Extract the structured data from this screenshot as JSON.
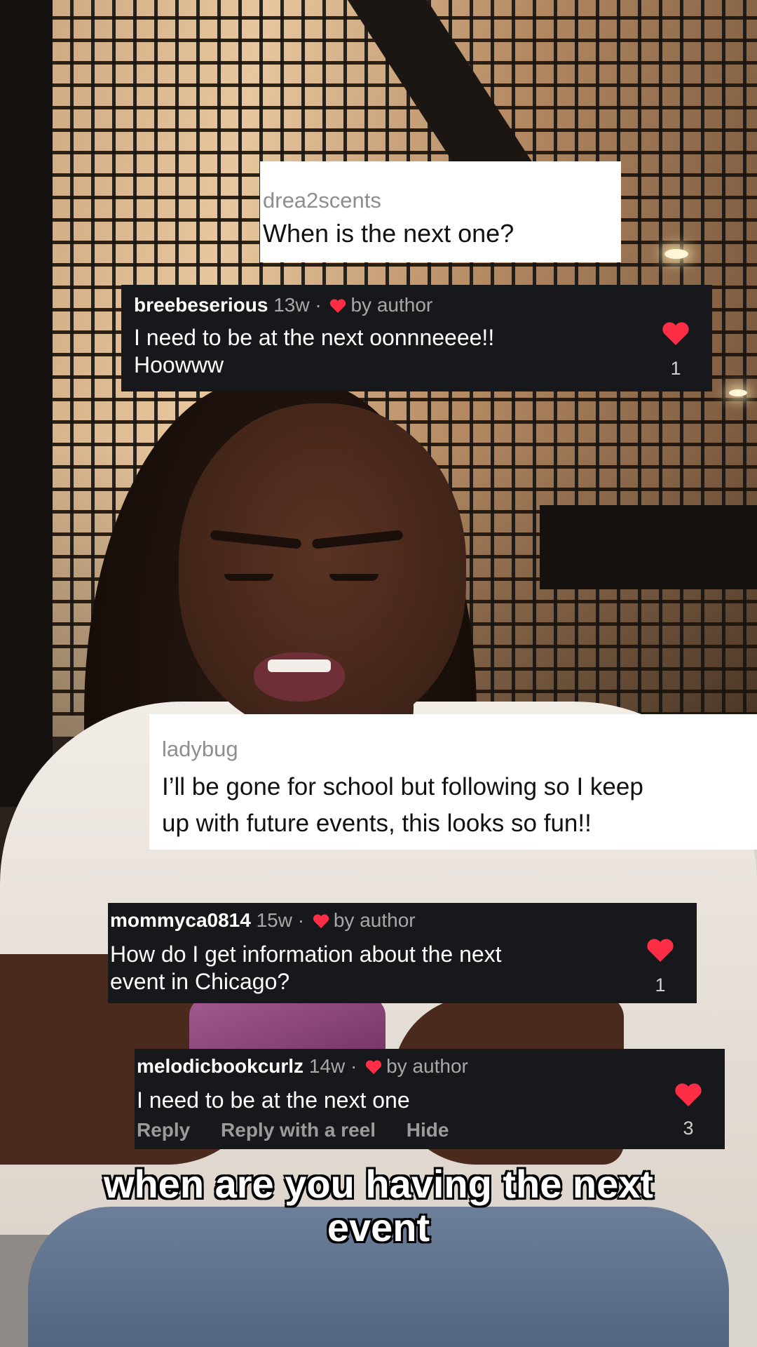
{
  "comments": {
    "c1": {
      "username": "drea2scents",
      "text": "When is the next one?"
    },
    "c2": {
      "username": "breebeserious",
      "age": "13w",
      "separator": "·",
      "liked_by": "by author",
      "text_line1": "I need to be at the next oonnneeee!!",
      "text_line2": "Hoowww",
      "likes": "1"
    },
    "c3": {
      "username": "ladybug",
      "text_line1": "I’ll be gone for school but following so I keep",
      "text_line2": "up with future events, this looks so fun!!"
    },
    "c4": {
      "username": "mommyca0814",
      "age": "15w",
      "separator": "·",
      "liked_by": "by author",
      "text_line1": "How do I get information about the next",
      "text_line2": "event in Chicago?",
      "likes": "1"
    },
    "c5": {
      "username": "melodicbookcurlz",
      "age": "14w",
      "separator": "·",
      "liked_by": "by author",
      "text": "I need to be at the next one",
      "likes": "3",
      "actions": {
        "reply": "Reply",
        "reply_reel": "Reply with a reel",
        "hide": "Hide"
      }
    }
  },
  "caption": {
    "line1": "when are you having the next",
    "line2": "event"
  },
  "colors": {
    "heart": "#ff2d45",
    "dark_card": "#17181c",
    "white_card": "#ffffff",
    "muted": "#a8a8a8"
  },
  "icons": {
    "like": "heart-icon",
    "author_like": "heart-mini-icon"
  }
}
